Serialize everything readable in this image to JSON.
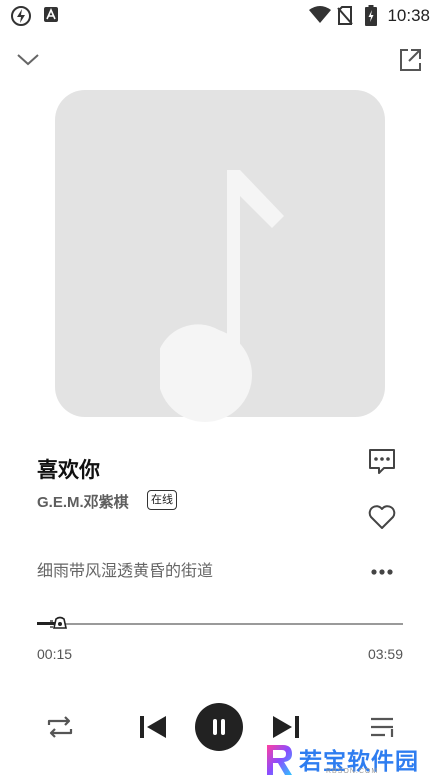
{
  "status_bar": {
    "time": "10:38",
    "left_icons": [
      "flash-icon",
      "a-icon"
    ],
    "right_icons": [
      "wifi-icon",
      "no-sim-icon",
      "battery-charging-icon"
    ]
  },
  "header": {
    "collapse_icon": "chevron-down-icon",
    "share_icon": "share-icon"
  },
  "album_art": {
    "placeholder_icon": "music-note-icon",
    "background_color": "#e3e3e3",
    "note_color": "#f5f5f5"
  },
  "song": {
    "title": "喜欢你",
    "artist": "G.E.M.邓紫棋",
    "badge": "在线",
    "lyric": "细雨带风湿透黄昏的街道"
  },
  "side_actions": [
    "comment-icon",
    "heart-icon",
    "more-icon"
  ],
  "progress": {
    "elapsed": "00:15",
    "total": "03:59",
    "fraction": 0.063
  },
  "controls": [
    "repeat-icon",
    "previous-icon",
    "pause-icon",
    "next-icon",
    "playlist-icon"
  ],
  "watermark": {
    "text": "若宝软件园",
    "sub": "RBSON.COM"
  }
}
